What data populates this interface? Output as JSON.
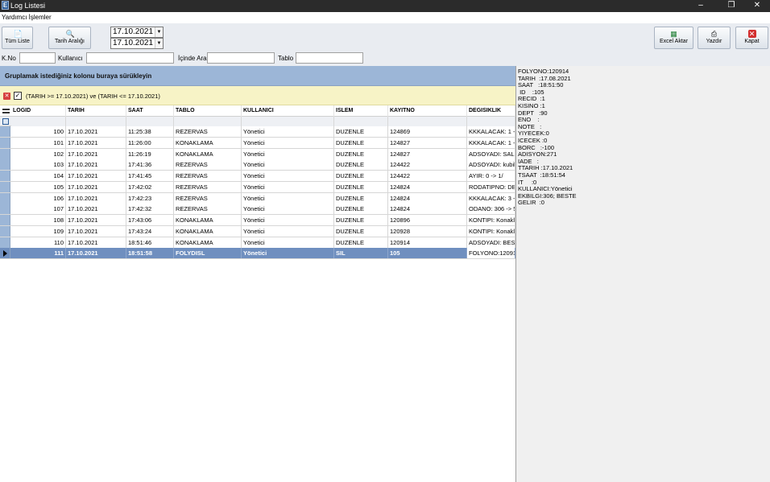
{
  "window": {
    "title": "Log Listesi",
    "icon": "E"
  },
  "menu": {
    "item": "Yardımcı İşlemler"
  },
  "toolbar": {
    "tum_liste": "Tüm Liste",
    "tarih_araligi": "Tarih Aralığı",
    "date_start": "17.10.2021",
    "date_end": "17.10.2021",
    "excel": "Excel Aktar",
    "yazdir": "Yazdır",
    "kapat": "Kapat"
  },
  "filters": {
    "kno": "K.No",
    "kullanici": "Kullanıcı",
    "icinde_ara": "İçinde Ara",
    "tablo": "Tablo"
  },
  "grid": {
    "group_hint": "Gruplamak istediğiniz kolonu buraya sürükleyin",
    "filter_text": "(TARIH >= 17.10.2021) ve (TARIH <= 17.10.2021)",
    "columns": [
      "LOGID",
      "TARIH",
      "SAAT",
      "TABLO",
      "KULLANICI",
      "ISLEM",
      "KAYITNO",
      "DEGISIKLIK"
    ],
    "rows": [
      [
        "100",
        "17.10.2021",
        "11:25:38",
        "REZERVAS",
        "Yönetici",
        "DUZENLE",
        "124869",
        "KKKALACAK: 1 -> 0"
      ],
      [
        "101",
        "17.10.2021",
        "11:26:00",
        "KONAKLAMA",
        "Yönetici",
        "DUZENLE",
        "124827",
        "KKKALACAK: 1 -> 0"
      ],
      [
        "102",
        "17.10.2021",
        "11:26:19",
        "KONAKLAMA",
        "Yönetici",
        "DUZENLE",
        "124827",
        "ADSOYADI: SALİH"
      ],
      [
        "103",
        "17.10.2021",
        "17:41:36",
        "REZERVAS",
        "Yönetici",
        "DUZENLE",
        "124422",
        "ADSOYADI: kubil"
      ],
      [
        "104",
        "17.10.2021",
        "17:41:45",
        "REZERVAS",
        "Yönetici",
        "DUZENLE",
        "124422",
        "AYIR: 0 -> 1/"
      ],
      [
        "105",
        "17.10.2021",
        "17:42:02",
        "REZERVAS",
        "Yönetici",
        "DUZENLE",
        "124824",
        "RODATIPNO: DB"
      ],
      [
        "106",
        "17.10.2021",
        "17:42:23",
        "REZERVAS",
        "Yönetici",
        "DUZENLE",
        "124824",
        "KKKALACAK: 3 ->"
      ],
      [
        "107",
        "17.10.2021",
        "17:42:32",
        "REZERVAS",
        "Yönetici",
        "DUZENLE",
        "124824",
        "ODANO: 306 -> 5"
      ],
      [
        "108",
        "17.10.2021",
        "17:43:06",
        "KONAKLAMA",
        "Yönetici",
        "DUZENLE",
        "120896",
        "KONTIPI: Konakl"
      ],
      [
        "109",
        "17.10.2021",
        "17:43:24",
        "KONAKLAMA",
        "Yönetici",
        "DUZENLE",
        "120928",
        "KONTIPI: Konakl"
      ],
      [
        "110",
        "17.10.2021",
        "18:51:46",
        "KONAKLAMA",
        "Yönetici",
        "DUZENLE",
        "120914",
        "ADSOYADI: BEST"
      ],
      [
        "111",
        "17.10.2021",
        "18:51:58",
        "FOLYDISL",
        "Yönetici",
        "SIL",
        "105",
        "FOLYONO:12091"
      ]
    ],
    "selected_index": 11
  },
  "detail": {
    "lines": [
      "FOLYONO:120914",
      "TARIH  :17.08.2021",
      "SAAT   :18:51:50",
      " ID    :105",
      "RECID  :1",
      "KISINO :1",
      "DEPT   :90",
      "ENO    :",
      "NOTE   :",
      "YIYECEK:0",
      "ICECEK :0",
      "BORC   :-100",
      "ADISYON:271",
      "IADE   :",
      "TTARIH :17.10.2021",
      "TSAAT  :18:51:54",
      "IT     :0",
      "KULLANICI:Yönetici",
      "EKBILGI:306; BESTE",
      "GELIR  :0"
    ]
  },
  "colors": {
    "accent": "#6f8fbf",
    "group_panel": "#9cb6d7",
    "filter_bar": "#f7f3c6"
  }
}
